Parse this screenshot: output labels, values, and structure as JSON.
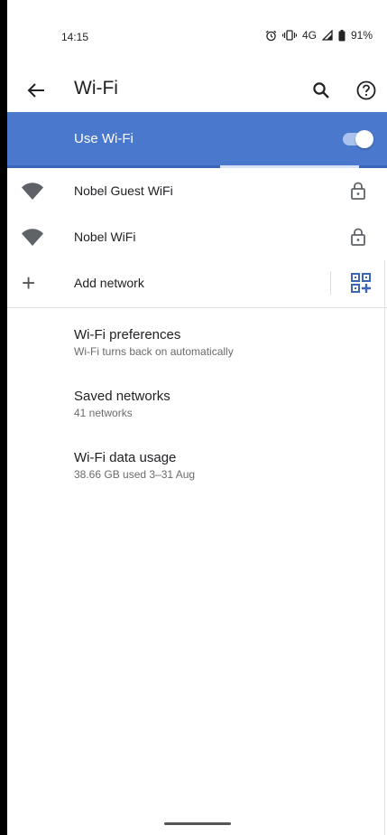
{
  "status_bar": {
    "time": "14:15",
    "network": "4G",
    "battery": "91%",
    "icons": [
      "alarm-icon",
      "vibrate-icon",
      "signal-icon",
      "battery-icon"
    ]
  },
  "app_bar": {
    "title": "Wi-Fi",
    "icons": [
      "back-arrow-icon",
      "search-icon",
      "help-icon"
    ]
  },
  "use_wifi": {
    "label": "Use Wi-Fi",
    "enabled": true,
    "accent_color": "#4a78cc"
  },
  "networks": [
    {
      "name": "Nobel Guest WiFi",
      "secured": true
    },
    {
      "name": "Nobel WiFi",
      "secured": true
    }
  ],
  "add_network": {
    "label": "Add network"
  },
  "preferences": [
    {
      "title": "Wi-Fi preferences",
      "subtitle": "Wi-Fi turns back on automatically"
    },
    {
      "title": "Saved networks",
      "subtitle": "41 networks"
    },
    {
      "title": "Wi-Fi data usage",
      "subtitle": "38.66 GB used 3–31 Aug"
    }
  ]
}
